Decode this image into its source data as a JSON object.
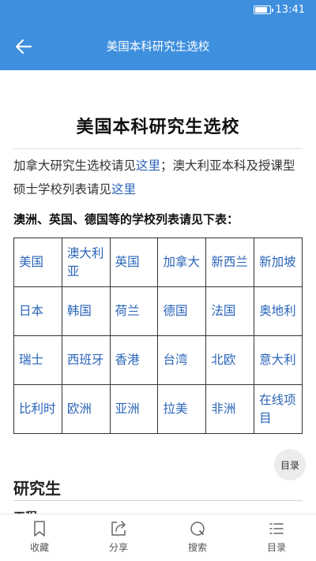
{
  "status_bar": {
    "time": "13:41",
    "battery_level": 0.9
  },
  "header": {
    "title": "美国本科研究生选校"
  },
  "article": {
    "title": "美国本科研究生选校",
    "intro": {
      "p1": "加拿大研究生选校请见",
      "link1": "这里",
      "p2": "；澳大利亚本科及授课型硕士学校列表请见",
      "link2": "这里"
    },
    "list_heading": "澳洲、英国、德国等的学校列表请见下表：",
    "table": [
      [
        "美国",
        "澳大利亚",
        "英国",
        "加拿大",
        "新西兰",
        "新加坡"
      ],
      [
        "日本",
        "韩国",
        "荷兰",
        "德国",
        "法国",
        "奥地利"
      ],
      [
        "瑞士",
        "西班牙",
        "香港",
        "台湾",
        "北欧",
        "意大利"
      ],
      [
        "比利时",
        "欧洲",
        "亚洲",
        "拉美",
        "非洲",
        "在线项目"
      ]
    ],
    "section_heading": "研究生",
    "next_heading": "工程"
  },
  "toc_button": "目录",
  "bottom_bar": [
    {
      "label": "收藏",
      "icon": "bookmark-icon"
    },
    {
      "label": "分享",
      "icon": "share-icon"
    },
    {
      "label": "搜索",
      "icon": "search-icon"
    },
    {
      "label": "目录",
      "icon": "list-icon"
    }
  ],
  "colors": {
    "primary": "#3f8fdf",
    "link": "#2a64b8"
  }
}
